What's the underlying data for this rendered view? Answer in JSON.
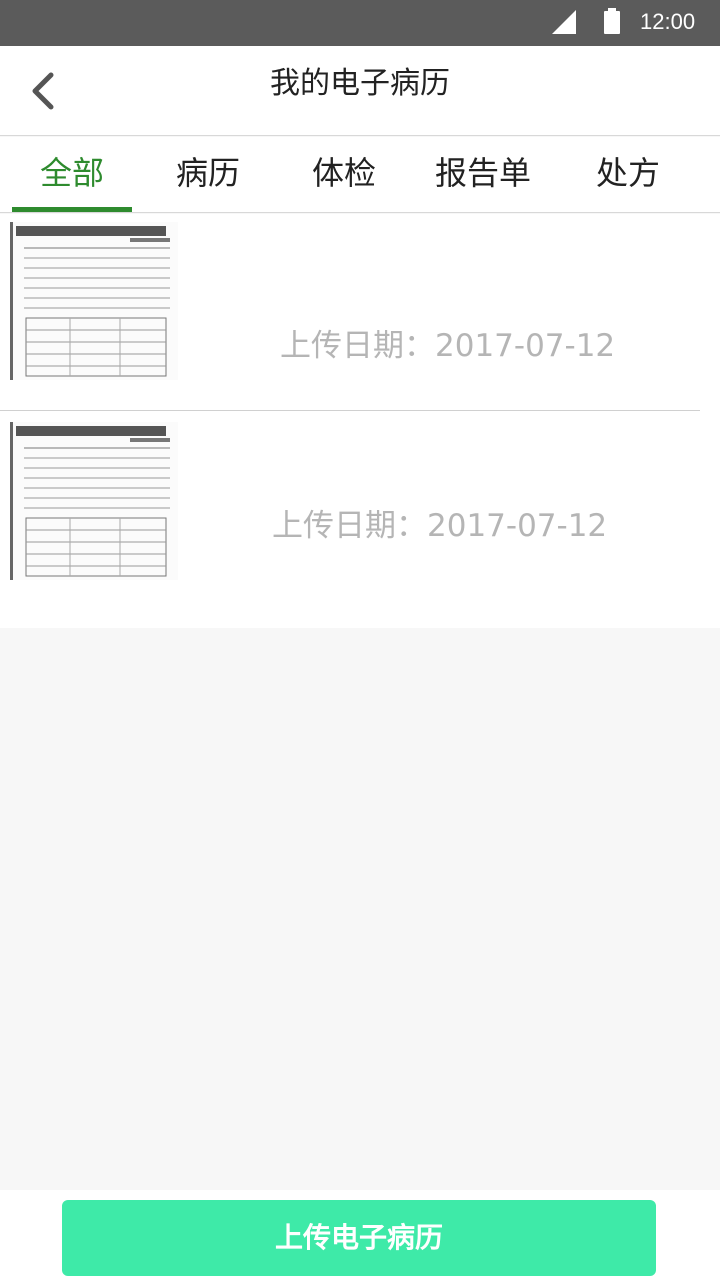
{
  "status_bar": {
    "time": "12:00",
    "signal_icon": "signal-icon",
    "battery_icon": "battery-icon"
  },
  "header": {
    "title": "我的电子病历",
    "back_icon": "chevron-left-icon"
  },
  "tabs": [
    {
      "label": "全部",
      "active": true
    },
    {
      "label": "病历",
      "active": false
    },
    {
      "label": "体检",
      "active": false
    },
    {
      "label": "报告单",
      "active": false
    },
    {
      "label": "处方",
      "active": false
    }
  ],
  "records": [
    {
      "upload_date": "上传日期：2017-07-12",
      "thumbnail_icon": "document-thumbnail"
    },
    {
      "upload_date": "上传日期：2017-07-12",
      "thumbnail_icon": "document-thumbnail"
    }
  ],
  "actions": {
    "upload_label": "上传电子病历"
  },
  "colors": {
    "accent": "#2e8b2e",
    "button": "#3eeaa8",
    "status_bar": "#5b5b5b",
    "date_text": "#b5b5b5"
  }
}
